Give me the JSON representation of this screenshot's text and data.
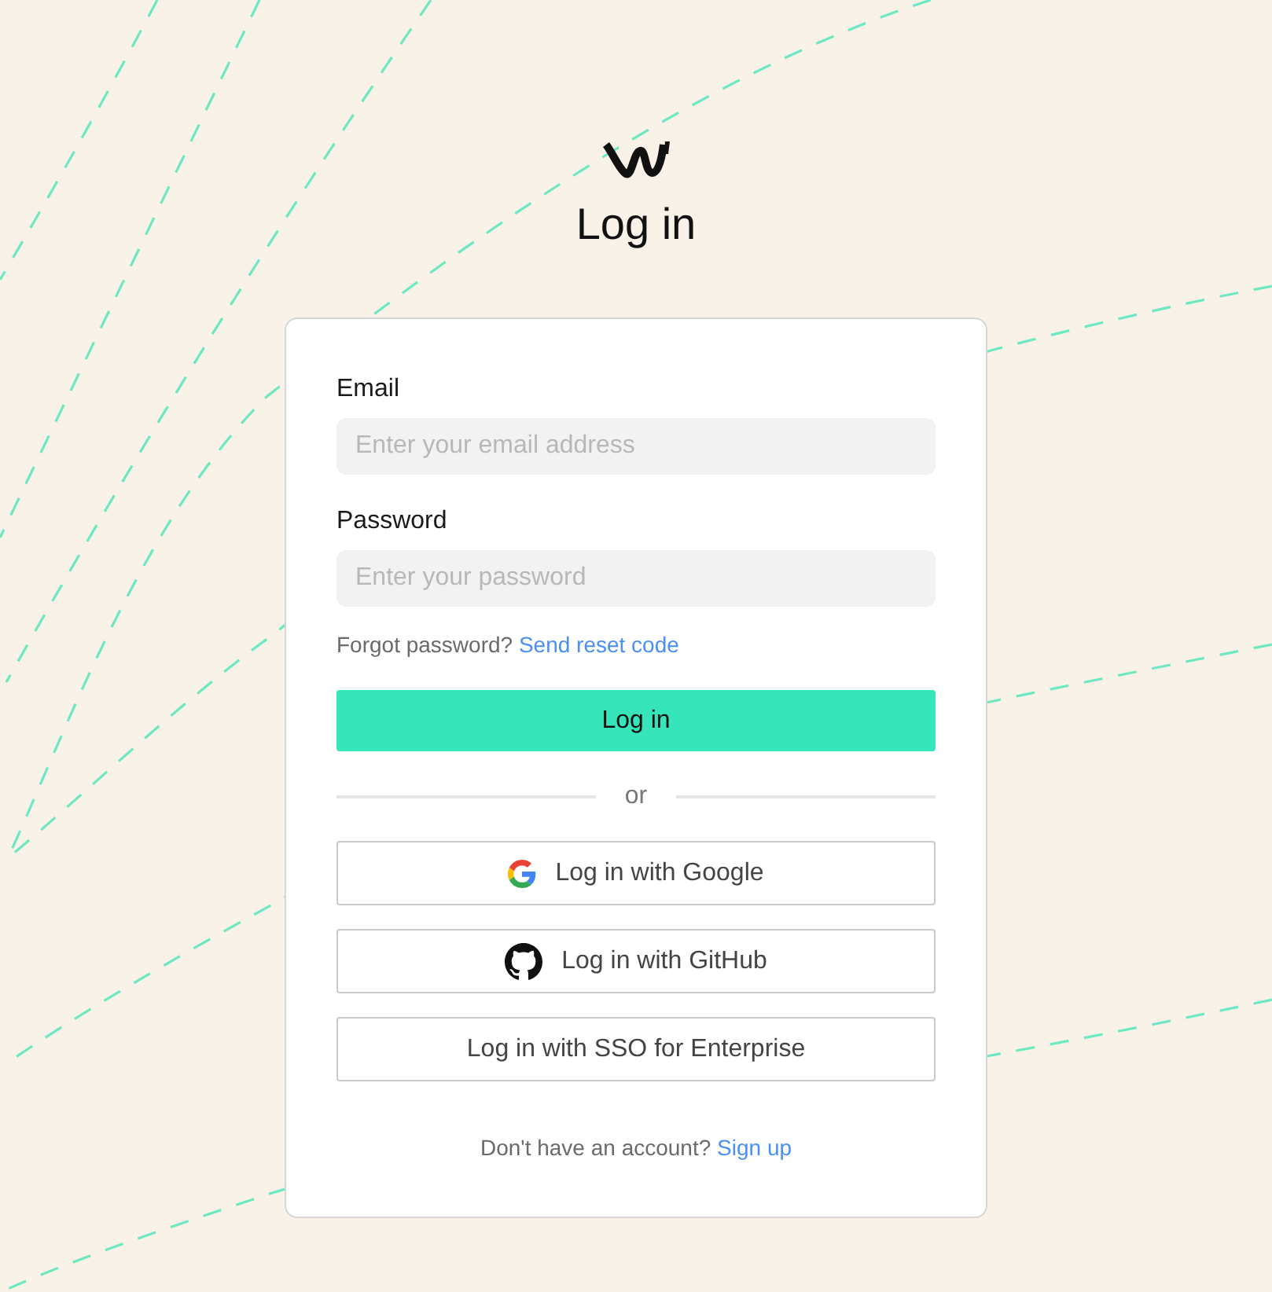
{
  "title": "Log in",
  "form": {
    "fields": [
      {
        "label": "Email",
        "placeholder": "Enter your email address"
      },
      {
        "label": "Password",
        "placeholder": "Enter your password"
      }
    ],
    "forgot": {
      "text": "Forgot password?",
      "link": "Send reset code"
    },
    "submit": "Log in",
    "divider": "or",
    "providers": [
      {
        "label": "Log in with Google",
        "kind": "google"
      },
      {
        "label": "Log in with GitHub",
        "kind": "github"
      },
      {
        "label": "Log in with SSO for Enterprise",
        "kind": "sso"
      }
    ],
    "signup": {
      "text": "Don't have an account?",
      "link": "Sign up"
    }
  }
}
